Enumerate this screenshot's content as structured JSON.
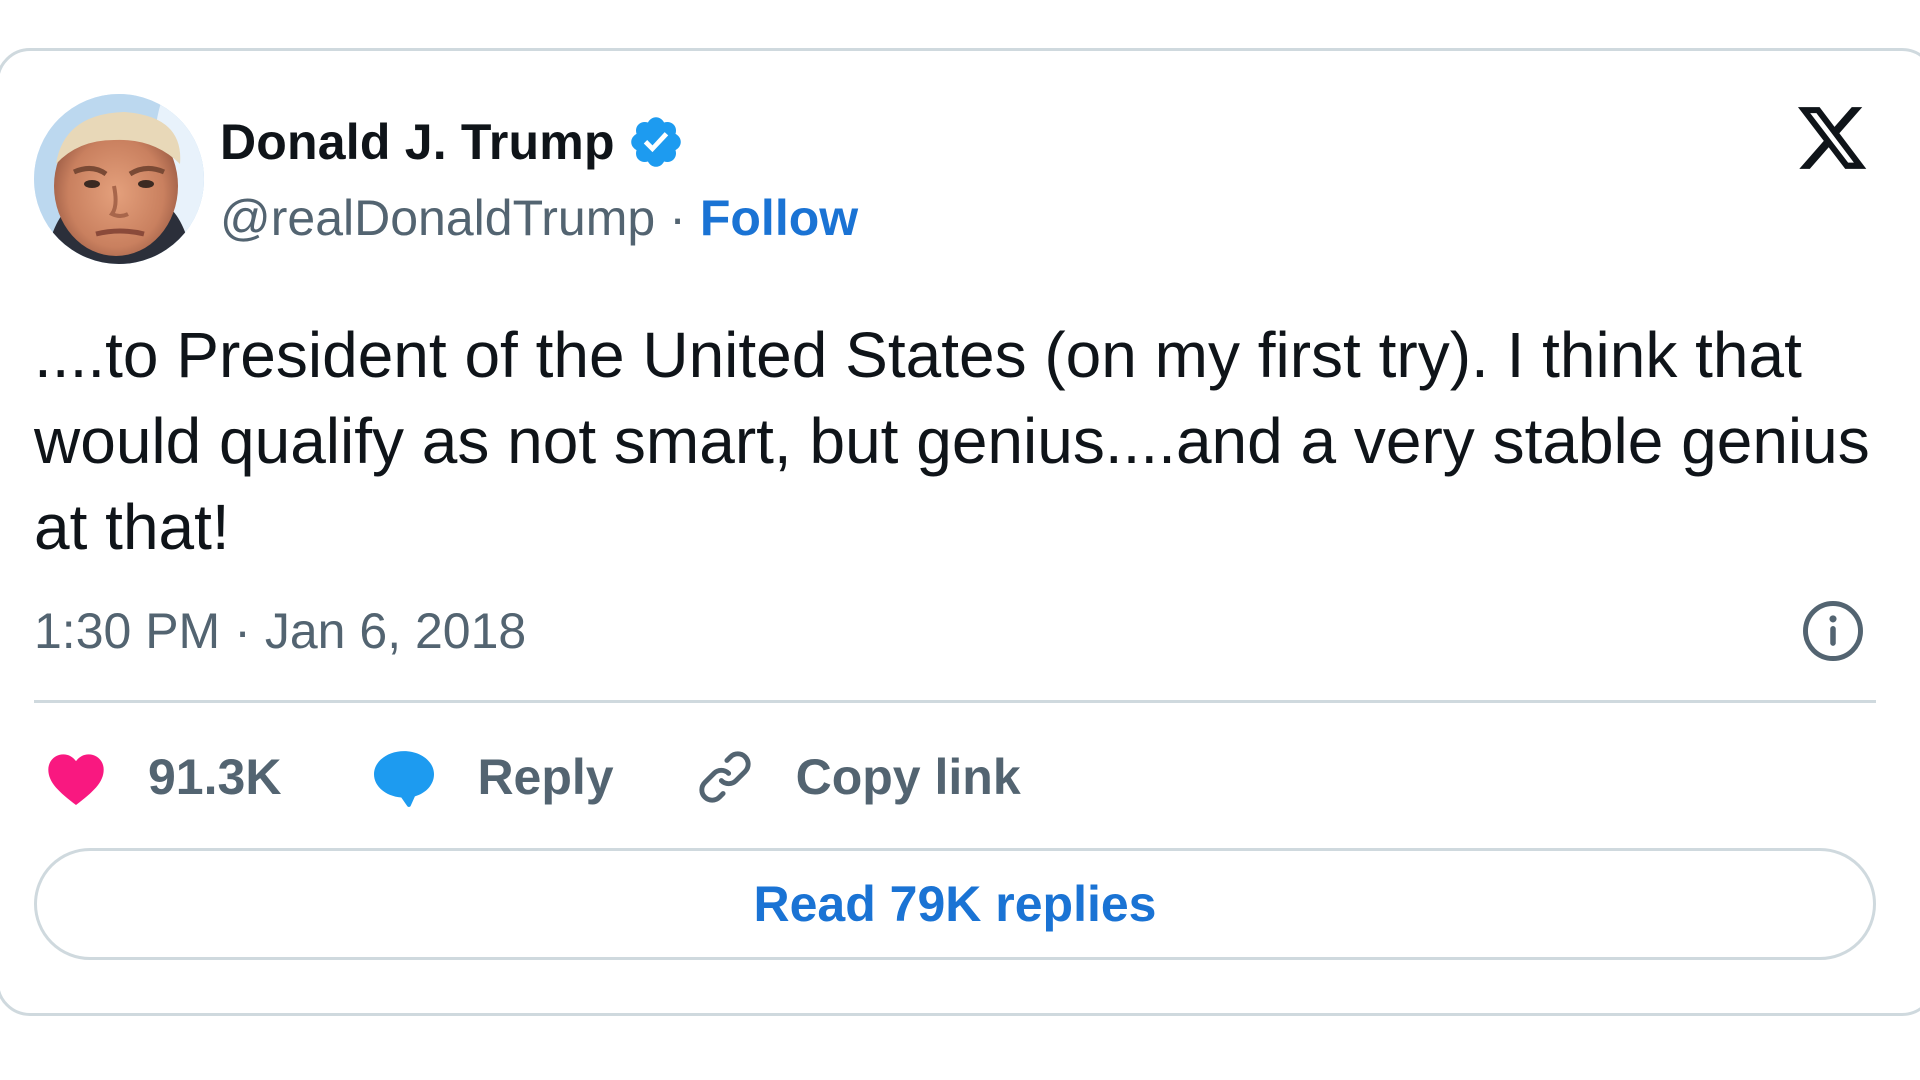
{
  "author": {
    "display_name": "Donald J. Trump",
    "handle": "@realDonaldTrump",
    "separator": "·",
    "follow_label": "Follow",
    "verified": true
  },
  "tweet": {
    "text": "....to President of the United States (on my first try). I think that would qualify as not smart, but genius....and a very stable genius at that!",
    "time": "1:30 PM",
    "separator": "·",
    "date": "Jan 6, 2018"
  },
  "actions": {
    "like_count": "91.3K",
    "reply_label": "Reply",
    "copy_link_label": "Copy link"
  },
  "read_replies_label": "Read 79K replies",
  "icons": {
    "brand": "x-logo-icon",
    "verified": "verified-badge-icon",
    "info": "info-icon",
    "like": "heart-icon",
    "reply": "speech-bubble-icon",
    "copy": "link-icon"
  },
  "colors": {
    "link_blue": "#1a73d4",
    "verified_blue": "#1d9bf0",
    "heart_pink": "#f91880",
    "secondary_text": "#536471",
    "border": "#cfd9de"
  }
}
